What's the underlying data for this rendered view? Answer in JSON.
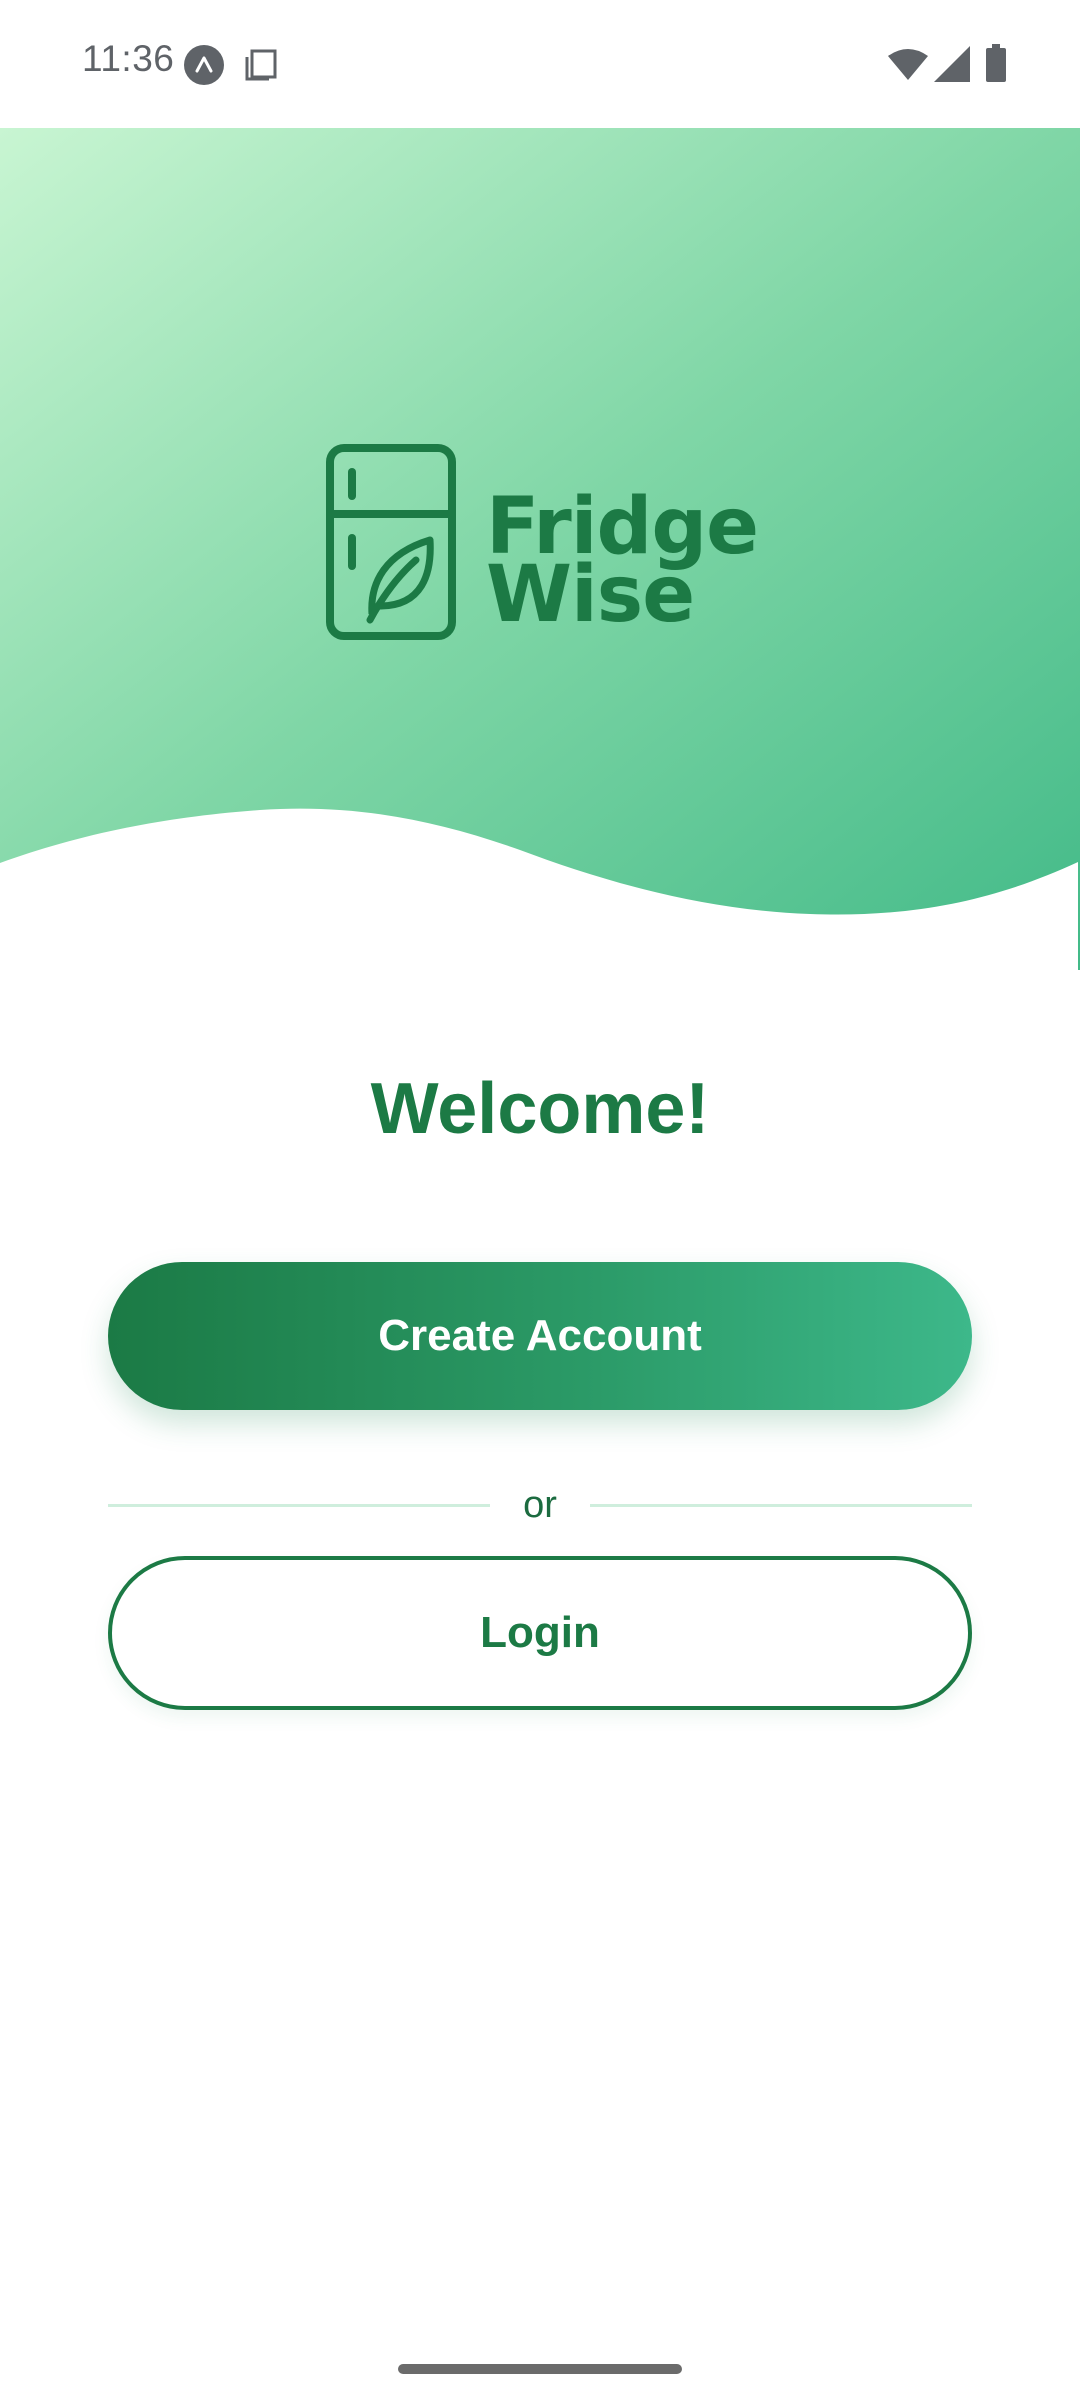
{
  "status_bar": {
    "time": "11:36",
    "icons": [
      "app-notification-icon",
      "copy-icon",
      "wifi-icon",
      "cell-signal-icon",
      "battery-icon"
    ]
  },
  "hero": {
    "logo": {
      "line1": "Fridge",
      "line2": "Wise",
      "icon": "fridge-leaf-icon"
    },
    "gradient_colors": [
      "#c8f5d2",
      "#7fd6a6",
      "#42ba88"
    ]
  },
  "welcome": {
    "title": "Welcome!"
  },
  "actions": {
    "create_account_label": "Create Account",
    "divider_label": "or",
    "login_label": "Login"
  },
  "colors": {
    "brand_green": "#1c7a45",
    "button_gradient_start": "#1b7a45",
    "button_gradient_end": "#3db88a",
    "divider": "#cfeedd"
  }
}
